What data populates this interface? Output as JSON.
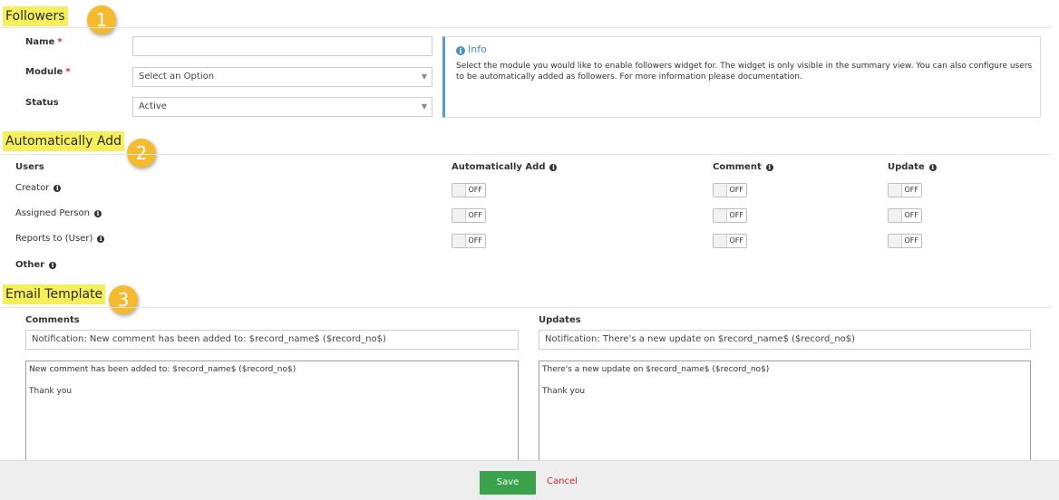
{
  "followers": {
    "section_title": "Followers",
    "step_number": "1",
    "name": {
      "label": "Name",
      "required_mark": "*",
      "value": ""
    },
    "module": {
      "label": "Module",
      "required_mark": "*",
      "value": "Select an Option"
    },
    "status": {
      "label": "Status",
      "value": "Active"
    },
    "info": {
      "title": "Info",
      "icon": "info-icon",
      "text": "Select the module you would like to enable followers widget for. The widget is only visible in the summary view. You can also configure users to be automatically added as followers. For more information please documentation."
    }
  },
  "automatically_add": {
    "section_title": "Automatically Add",
    "step_number": "2",
    "columns": {
      "users": "Users",
      "automatically_add": "Automatically Add",
      "comment": "Comment",
      "update": "Update"
    },
    "rows": [
      {
        "label": "Creator",
        "auto": "OFF",
        "comment": "OFF",
        "update": "OFF"
      },
      {
        "label": "Assigned Person",
        "auto": "OFF",
        "comment": "OFF",
        "update": "OFF"
      },
      {
        "label": "Reports to (User)",
        "auto": "OFF",
        "comment": "OFF",
        "update": "OFF"
      }
    ],
    "other_label": "Other"
  },
  "email_template": {
    "section_title": "Email Template",
    "step_number": "3",
    "comments": {
      "label": "Comments",
      "subject": "Notification: New comment has been added to: $record_name$ ($record_no$)",
      "body": "New comment has been added to: $record_name$ ($record_no$)\n\nThank you"
    },
    "updates": {
      "label": "Updates",
      "subject": "Notification: There's a new update on $record_name$ ($record_no$)",
      "body": "There's a new update on $record_name$ ($record_no$)\n\nThank you"
    }
  },
  "footer": {
    "save_label": "Save",
    "cancel_label": "Cancel"
  },
  "colors": {
    "highlight": "#f5ef5c",
    "badge": "#f5ba2e",
    "save": "#3aa24a",
    "cancel": "#d9232d",
    "info_accent": "#5a9bc9",
    "required": "#d9232d"
  }
}
